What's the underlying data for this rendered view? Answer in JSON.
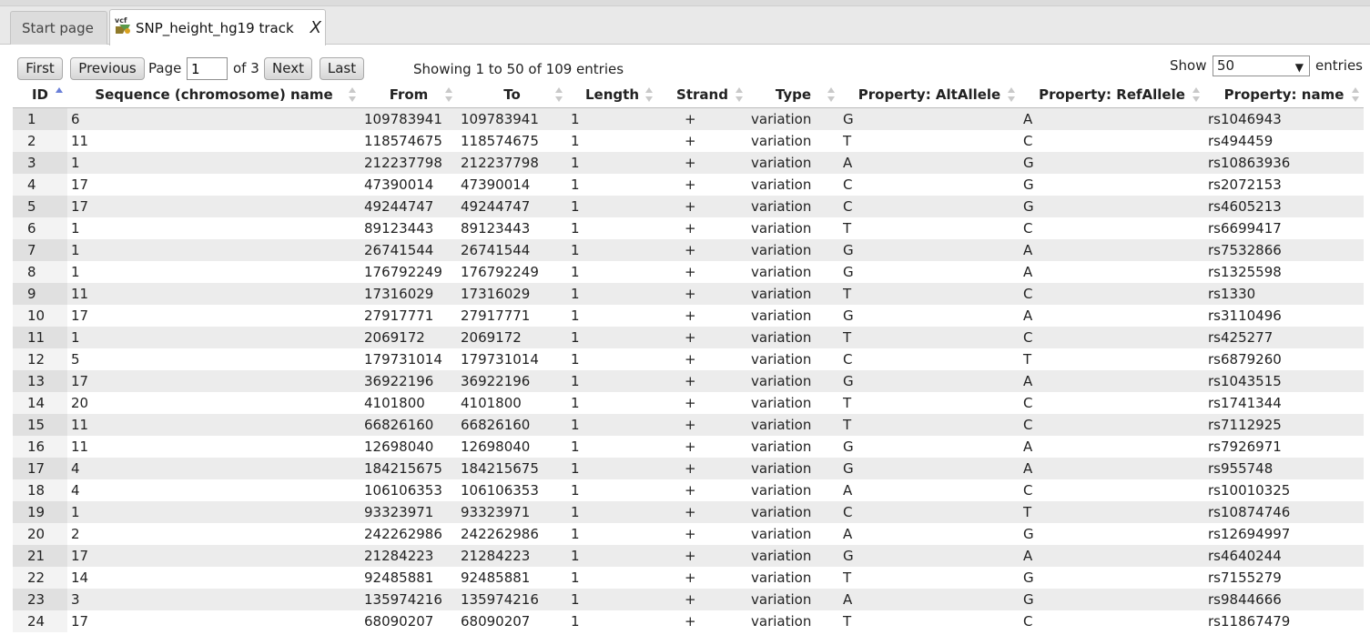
{
  "tabs": [
    {
      "label": "Start page"
    },
    {
      "label": "SNP_height_hg19 track",
      "icon": "vcf-file-icon",
      "close": "X"
    }
  ],
  "pager": {
    "first": "First",
    "previous": "Previous",
    "page_label": "Page",
    "page_value": "1",
    "of_label": "of 3",
    "next": "Next",
    "last": "Last",
    "info": "Showing 1 to 50 of 109 entries",
    "show_label": "Show",
    "show_value": "50",
    "entries_label": "entries"
  },
  "table": {
    "columns": [
      "ID",
      "Sequence (chromosome) name",
      "From",
      "To",
      "Length",
      "Strand",
      "Type",
      "Property: AltAllele",
      "Property: RefAllele",
      "Property: name"
    ],
    "sorted_column": "ID",
    "rows": [
      [
        "1",
        "6",
        "109783941",
        "109783941",
        "1",
        "+",
        "variation",
        "G",
        "A",
        "rs1046943"
      ],
      [
        "2",
        "11",
        "118574675",
        "118574675",
        "1",
        "+",
        "variation",
        "T",
        "C",
        "rs494459"
      ],
      [
        "3",
        "1",
        "212237798",
        "212237798",
        "1",
        "+",
        "variation",
        "A",
        "G",
        "rs10863936"
      ],
      [
        "4",
        "17",
        "47390014",
        "47390014",
        "1",
        "+",
        "variation",
        "C",
        "G",
        "rs2072153"
      ],
      [
        "5",
        "17",
        "49244747",
        "49244747",
        "1",
        "+",
        "variation",
        "C",
        "G",
        "rs4605213"
      ],
      [
        "6",
        "1",
        "89123443",
        "89123443",
        "1",
        "+",
        "variation",
        "T",
        "C",
        "rs6699417"
      ],
      [
        "7",
        "1",
        "26741544",
        "26741544",
        "1",
        "+",
        "variation",
        "G",
        "A",
        "rs7532866"
      ],
      [
        "8",
        "1",
        "176792249",
        "176792249",
        "1",
        "+",
        "variation",
        "G",
        "A",
        "rs1325598"
      ],
      [
        "9",
        "11",
        "17316029",
        "17316029",
        "1",
        "+",
        "variation",
        "T",
        "C",
        "rs1330"
      ],
      [
        "10",
        "17",
        "27917771",
        "27917771",
        "1",
        "+",
        "variation",
        "G",
        "A",
        "rs3110496"
      ],
      [
        "11",
        "1",
        "2069172",
        "2069172",
        "1",
        "+",
        "variation",
        "T",
        "C",
        "rs425277"
      ],
      [
        "12",
        "5",
        "179731014",
        "179731014",
        "1",
        "+",
        "variation",
        "C",
        "T",
        "rs6879260"
      ],
      [
        "13",
        "17",
        "36922196",
        "36922196",
        "1",
        "+",
        "variation",
        "G",
        "A",
        "rs1043515"
      ],
      [
        "14",
        "20",
        "4101800",
        "4101800",
        "1",
        "+",
        "variation",
        "T",
        "C",
        "rs1741344"
      ],
      [
        "15",
        "11",
        "66826160",
        "66826160",
        "1",
        "+",
        "variation",
        "T",
        "C",
        "rs7112925"
      ],
      [
        "16",
        "11",
        "12698040",
        "12698040",
        "1",
        "+",
        "variation",
        "G",
        "A",
        "rs7926971"
      ],
      [
        "17",
        "4",
        "184215675",
        "184215675",
        "1",
        "+",
        "variation",
        "G",
        "A",
        "rs955748"
      ],
      [
        "18",
        "4",
        "106106353",
        "106106353",
        "1",
        "+",
        "variation",
        "A",
        "C",
        "rs10010325"
      ],
      [
        "19",
        "1",
        "93323971",
        "93323971",
        "1",
        "+",
        "variation",
        "C",
        "T",
        "rs10874746"
      ],
      [
        "20",
        "2",
        "242262986",
        "242262986",
        "1",
        "+",
        "variation",
        "A",
        "G",
        "rs12694997"
      ],
      [
        "21",
        "17",
        "21284223",
        "21284223",
        "1",
        "+",
        "variation",
        "G",
        "A",
        "rs4640244"
      ],
      [
        "22",
        "14",
        "92485881",
        "92485881",
        "1",
        "+",
        "variation",
        "T",
        "G",
        "rs7155279"
      ],
      [
        "23",
        "3",
        "135974216",
        "135974216",
        "1",
        "+",
        "variation",
        "A",
        "G",
        "rs9844666"
      ],
      [
        "24",
        "17",
        "68090207",
        "68090207",
        "1",
        "+",
        "variation",
        "T",
        "C",
        "rs11867479"
      ]
    ]
  },
  "colors": {
    "row_odd": "#ececec",
    "row_even": "#ffffff",
    "sort_active": "#6a7fd8",
    "sort_inactive": "#c9c9c9"
  }
}
